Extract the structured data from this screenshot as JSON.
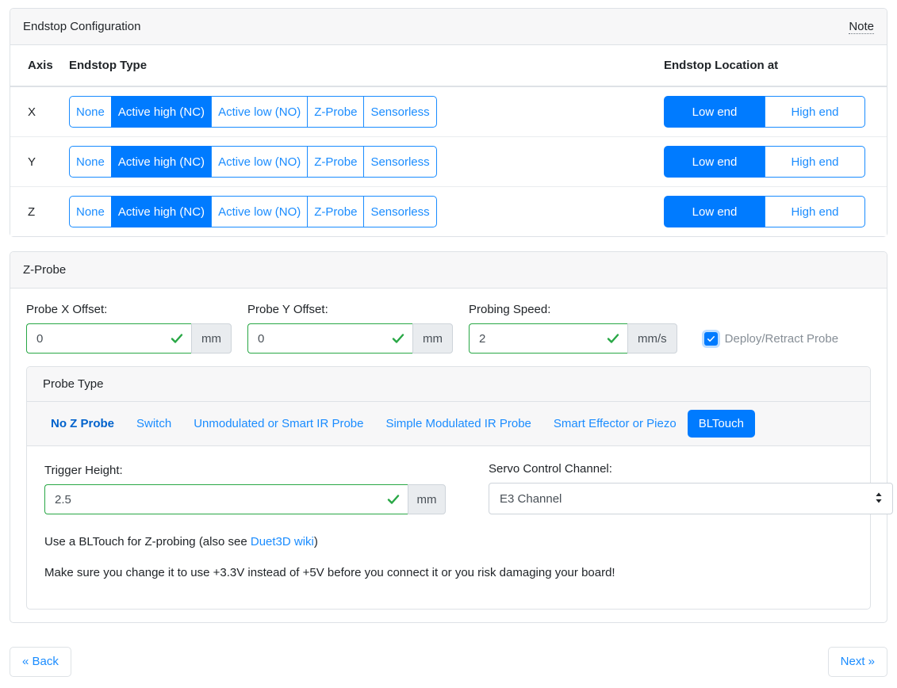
{
  "endstop_card": {
    "title": "Endstop Configuration",
    "note_label": "Note",
    "columns": {
      "axis": "Axis",
      "endstop_type": "Endstop Type",
      "endstop_location": "Endstop Location at"
    },
    "type_options": [
      "None",
      "Active high (NC)",
      "Active low (NO)",
      "Z-Probe",
      "Sensorless"
    ],
    "location_options": [
      "Low end",
      "High end"
    ],
    "rows": [
      {
        "axis": "X",
        "selected_type": "Active high (NC)",
        "selected_location": "Low end"
      },
      {
        "axis": "Y",
        "selected_type": "Active high (NC)",
        "selected_location": "Low end"
      },
      {
        "axis": "Z",
        "selected_type": "Active high (NC)",
        "selected_location": "Low end"
      }
    ]
  },
  "zprobe_card": {
    "title": "Z-Probe",
    "probe_x_offset": {
      "label": "Probe X Offset:",
      "value": "0",
      "unit": "mm"
    },
    "probe_y_offset": {
      "label": "Probe Y Offset:",
      "value": "0",
      "unit": "mm"
    },
    "probing_speed": {
      "label": "Probing Speed:",
      "value": "2",
      "unit": "mm/s"
    },
    "deploy_retract": {
      "label": "Deploy/Retract Probe",
      "checked": true
    },
    "probe_type": {
      "title": "Probe Type",
      "tabs": [
        "No Z Probe",
        "Switch",
        "Unmodulated or Smart IR Probe",
        "Simple Modulated IR Probe",
        "Smart Effector or Piezo",
        "BLTouch"
      ],
      "active_tab": "BLTouch",
      "hovered_tab": "No Z Probe"
    },
    "trigger_height": {
      "label": "Trigger Height:",
      "value": "2.5",
      "unit": "mm"
    },
    "servo_channel": {
      "label": "Servo Control Channel:",
      "value": "E3 Channel",
      "options": [
        "E3 Channel"
      ]
    },
    "description_1_prefix": "Use a BLTouch for Z-probing (also see ",
    "description_1_link": "Duet3D wiki",
    "description_1_suffix": ")",
    "description_2": "Make sure you change it to use +3.3V instead of +5V before you connect it or you risk damaging your board!"
  },
  "footer": {
    "back_label": "« Back",
    "next_label": "Next »"
  },
  "colors": {
    "primary": "#007bff",
    "link": "#1a8cff",
    "valid": "#28a745",
    "muted": "#868e96",
    "border": "#dee2e6",
    "header_bg": "#f7f7f8"
  }
}
